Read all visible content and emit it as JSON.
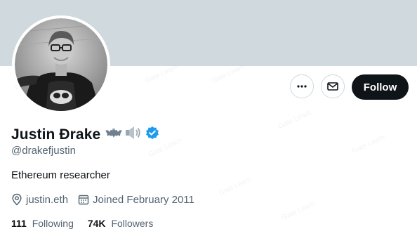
{
  "profile": {
    "display_name": "Justin Ðrake",
    "name_emojis": [
      "bat-icon",
      "speaker-icon"
    ],
    "verified": true,
    "handle": "@drakefjustin",
    "bio": "Ethereum researcher",
    "location": "justin.eth",
    "joined": "Joined February 2011",
    "following_count": "111",
    "following_label": "Following",
    "followers_count": "74K",
    "followers_label": "Followers"
  },
  "actions": {
    "more_icon": "more-icon",
    "message_icon": "envelope-icon",
    "follow_label": "Follow"
  },
  "colors": {
    "banner": "#cfd9de",
    "verified_badge": "#1d9bf0",
    "follow_button_bg": "#0f1419",
    "secondary_text": "#536471"
  }
}
